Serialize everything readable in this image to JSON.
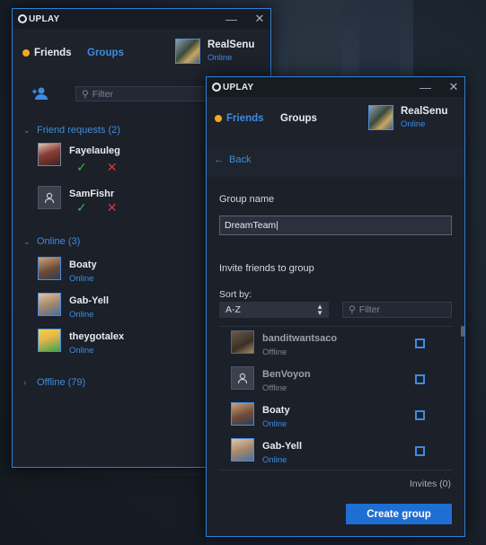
{
  "friends_window": {
    "logo": "UPLAY",
    "tabs": [
      {
        "label": "Friends"
      },
      {
        "label": "Groups"
      }
    ],
    "profile": {
      "name": "RealSenu",
      "status": "Online"
    },
    "filter_placeholder": "Filter",
    "sections": {
      "requests": "Friend requests (2)",
      "online": "Online (3)",
      "offline": "Offline (79)"
    },
    "requests": [
      {
        "name": "Fayelauleg"
      },
      {
        "name": "SamFishr"
      }
    ],
    "online": [
      {
        "name": "Boaty",
        "status": "Online"
      },
      {
        "name": "Gab-Yell",
        "status": "Online"
      },
      {
        "name": "theygotalex",
        "status": "Online"
      }
    ]
  },
  "group_window": {
    "logo": "UPLAY",
    "tabs": [
      {
        "label": "Friends"
      },
      {
        "label": "Groups"
      }
    ],
    "profile": {
      "name": "RealSenu",
      "status": "Online"
    },
    "back_label": "Back",
    "group_name_label": "Group name",
    "group_name_value": "DreamTeam",
    "invite_label": "Invite friends to group",
    "sort_label": "Sort by:",
    "sort_value": "A-Z",
    "filter_placeholder": "Filter",
    "invite_list": [
      {
        "name": "banditwantsaco",
        "status": "Offline"
      },
      {
        "name": "BenVoyon",
        "status": "Offline"
      },
      {
        "name": "Boaty",
        "status": "Online"
      },
      {
        "name": "Gab-Yell",
        "status": "Online"
      }
    ],
    "invites_count": "Invites (0)",
    "create_label": "Create group"
  },
  "colors": {
    "accent": "#1f6ed3",
    "online": "#3e8ce0",
    "friends_dot": "#f6a81a",
    "accept": "#3cb54a",
    "decline": "#d9363e"
  }
}
